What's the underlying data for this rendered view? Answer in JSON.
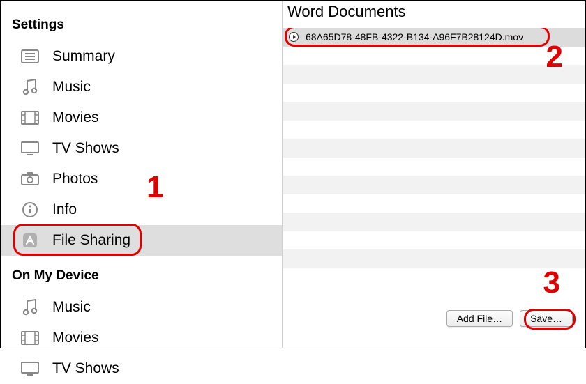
{
  "sidebar": {
    "settings_header": "Settings",
    "on_my_device_header": "On My Device",
    "items_settings": [
      {
        "label": "Summary",
        "icon": "summary-icon"
      },
      {
        "label": "Music",
        "icon": "music-icon"
      },
      {
        "label": "Movies",
        "icon": "movies-icon"
      },
      {
        "label": "TV Shows",
        "icon": "tv-icon"
      },
      {
        "label": "Photos",
        "icon": "photos-icon"
      },
      {
        "label": "Info",
        "icon": "info-icon"
      },
      {
        "label": "File Sharing",
        "icon": "apps-icon"
      }
    ],
    "items_device": [
      {
        "label": "Music",
        "icon": "music-icon"
      },
      {
        "label": "Movies",
        "icon": "movies-icon"
      },
      {
        "label": "TV Shows",
        "icon": "tv-icon"
      }
    ],
    "selected": "File Sharing"
  },
  "main": {
    "title": "Word Documents",
    "files": [
      {
        "name": "68A65D78-48FB-4322-B134-A96F7B28124D.mov",
        "selected": true
      }
    ],
    "buttons": {
      "add_file": "Add File…",
      "save": "Save…"
    }
  },
  "annotations": {
    "one": "1",
    "two": "2",
    "three": "3"
  }
}
